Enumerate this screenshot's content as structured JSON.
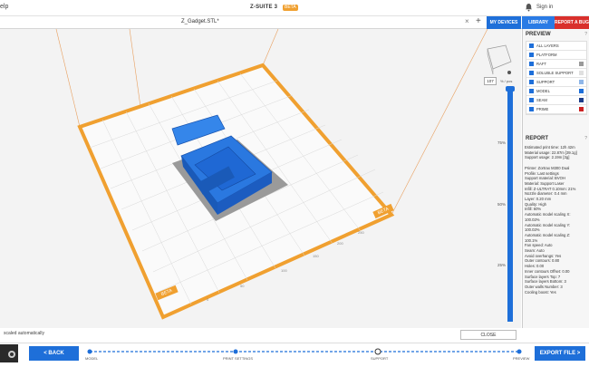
{
  "app": {
    "title": "Z-SUITE 3",
    "badge": "BETA",
    "menu_help": "elp",
    "sign_in": "Sign in"
  },
  "tabs": {
    "file_name": "Z_Gadget.STL*",
    "close": "×",
    "add": "+"
  },
  "top_buttons": {
    "my_devices": "MY DEVICES",
    "library": "LIBRARY",
    "report_bug": "REPORT A BUG"
  },
  "viewport": {
    "beta_corner_1": "BETA",
    "beta_corner_2": "BETA",
    "layer_value": "107",
    "layer_unit": "% / pos",
    "pct_75": "75%",
    "pct_50": "50%",
    "pct_25": "25%"
  },
  "preview": {
    "title": "PREVIEW",
    "items": [
      {
        "label": "ALL LAYERS",
        "color": ""
      },
      {
        "label": "PLATFORM",
        "color": ""
      },
      {
        "label": "RAFT",
        "color": "#9a9a9a"
      },
      {
        "label": "SOLUBLE SUPPORT",
        "color": "#e0e0e0"
      },
      {
        "label": "SUPPORT",
        "color": "#8fb6e8"
      },
      {
        "label": "MODEL",
        "color": "#1e6fd9"
      },
      {
        "label": "SEAM",
        "color": "#1d3d8a"
      },
      {
        "label": "PRIME",
        "color": "#cc2222"
      }
    ]
  },
  "report": {
    "title": "REPORT",
    "lines": [
      "Estimated print time: 12h 42m",
      "Material usage: 22.87m [39.1g]",
      "Support usage: 2.19m [3g]",
      "",
      "Printer: Zortrax M300 Dual",
      "Profile: Last settings",
      "Support material: BVOH",
      "Material: Support Laser",
      "Infill: Z-ULTRAT 0.10mm: 21%",
      "Nozzle diameter: 0.4 mm",
      "Layer: 0.20 mm",
      "Quality: High",
      "Infill: 60%",
      "Automatic model scaling X:",
      "100.02%",
      "Automatic model scaling Y:",
      "100.02%",
      "Automatic model scaling Z:",
      "100.1%",
      "Fan speed: Auto",
      "Seam: Auto",
      "Avoid overhangs: Yes",
      "Outer contours: 0.80",
      "Holes: 0.00",
      "Inner contours Offset: 0.00",
      "Surface layers Top: 7",
      "Surface layers Bottom: 3",
      "Outer walls Number: 3",
      "Cooling boost: Yes"
    ]
  },
  "bottom": {
    "auto_label": "scaled automatically",
    "close": "CLOSE",
    "back": "< BACK",
    "export": "EXPORT FILE >",
    "steps": [
      "MODEL",
      "PRINT SETTINGS",
      "SUPPORT",
      "PREVIEW"
    ]
  },
  "colors": {
    "accent": "#1e6fd9",
    "platform": "#f0a030",
    "danger": "#d9302c"
  }
}
